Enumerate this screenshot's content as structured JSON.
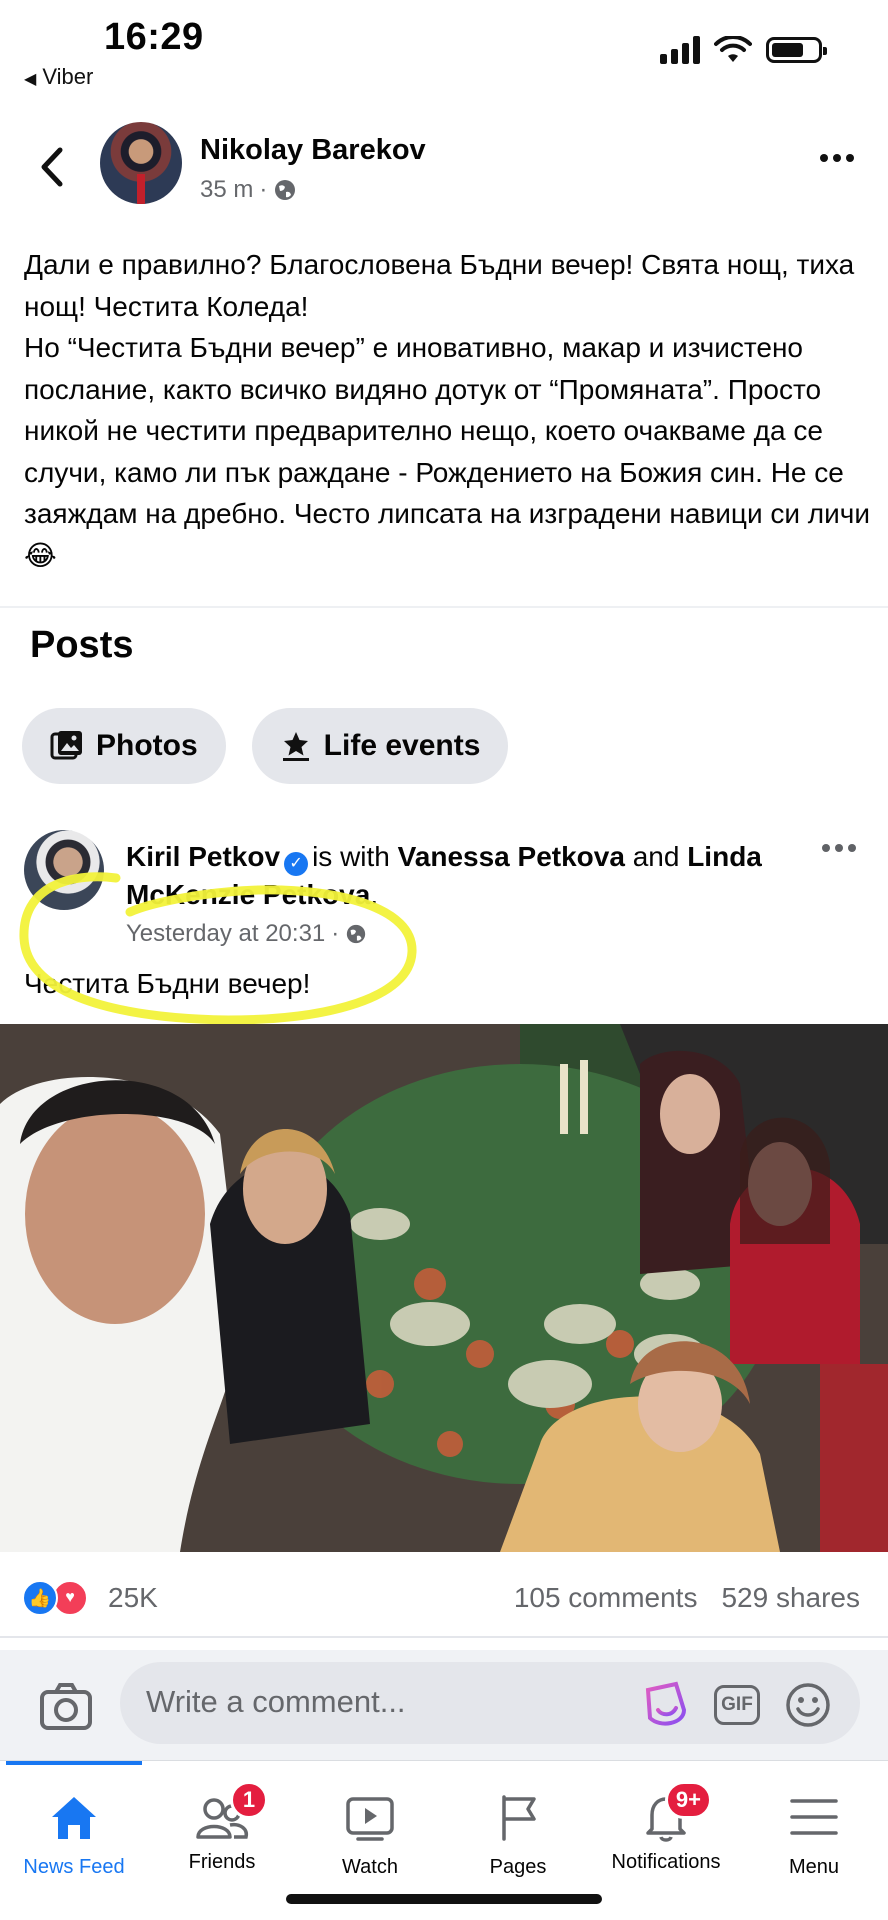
{
  "status_bar": {
    "time": "16:29",
    "back_app": "Viber",
    "back_glyph": "◀"
  },
  "post": {
    "author": "Nikolay Barekov",
    "time": "35 m",
    "dot": "·",
    "text": "Дали е правилно? Благословена Бъдни вечер! Свята нощ, тиха нощ! Честита Коледа!\nНо “Честита Бъдни вечер” е иновативно, макар и изчистено послание, както всичко видяно дотук от “Промяната”. Просто никой не честити предварително нещо, което очакваме да се случи, камо ли пък раждане - Рождението на Божия син. Не се заяждам на дребно. Често липсата на изградени навици си личи😂"
  },
  "posts_section": {
    "title": "Posts",
    "chips": [
      {
        "label": "Photos",
        "icon": "photos-icon"
      },
      {
        "label": "Life events",
        "icon": "star-flag-icon"
      }
    ]
  },
  "shared_post": {
    "author": "Kiril Petkov",
    "verified_glyph": "✓",
    "with_text": "is with",
    "tagged_1": "Vanessa Petkova",
    "and_text": "and",
    "tagged_2": "Linda McKenzie Petkova",
    "period": ".",
    "time": "Yesterday at 20:31",
    "dot": "·",
    "message": "Честита Бъдни вечер!",
    "highlight_color": "#f2f23a"
  },
  "reactions": {
    "like_glyph": "👍",
    "love_glyph": "♥",
    "count": "25K",
    "comments": "105 comments",
    "shares": "529 shares"
  },
  "comment_bar": {
    "placeholder": "Write a comment...",
    "gif_label": "GIF"
  },
  "tabbar": {
    "tabs": [
      {
        "label": "News Feed",
        "icon": "home-icon",
        "active": true
      },
      {
        "label": "Friends",
        "icon": "friends-icon",
        "badge": "1"
      },
      {
        "label": "Watch",
        "icon": "watch-icon"
      },
      {
        "label": "Pages",
        "icon": "flag-icon"
      },
      {
        "label": "Notifications",
        "icon": "bell-icon",
        "badge": "9+"
      },
      {
        "label": "Menu",
        "icon": "menu-icon"
      }
    ]
  },
  "colors": {
    "accent": "#1877f2",
    "badge": "#e41e3f",
    "highlight": "#f2f23a"
  }
}
